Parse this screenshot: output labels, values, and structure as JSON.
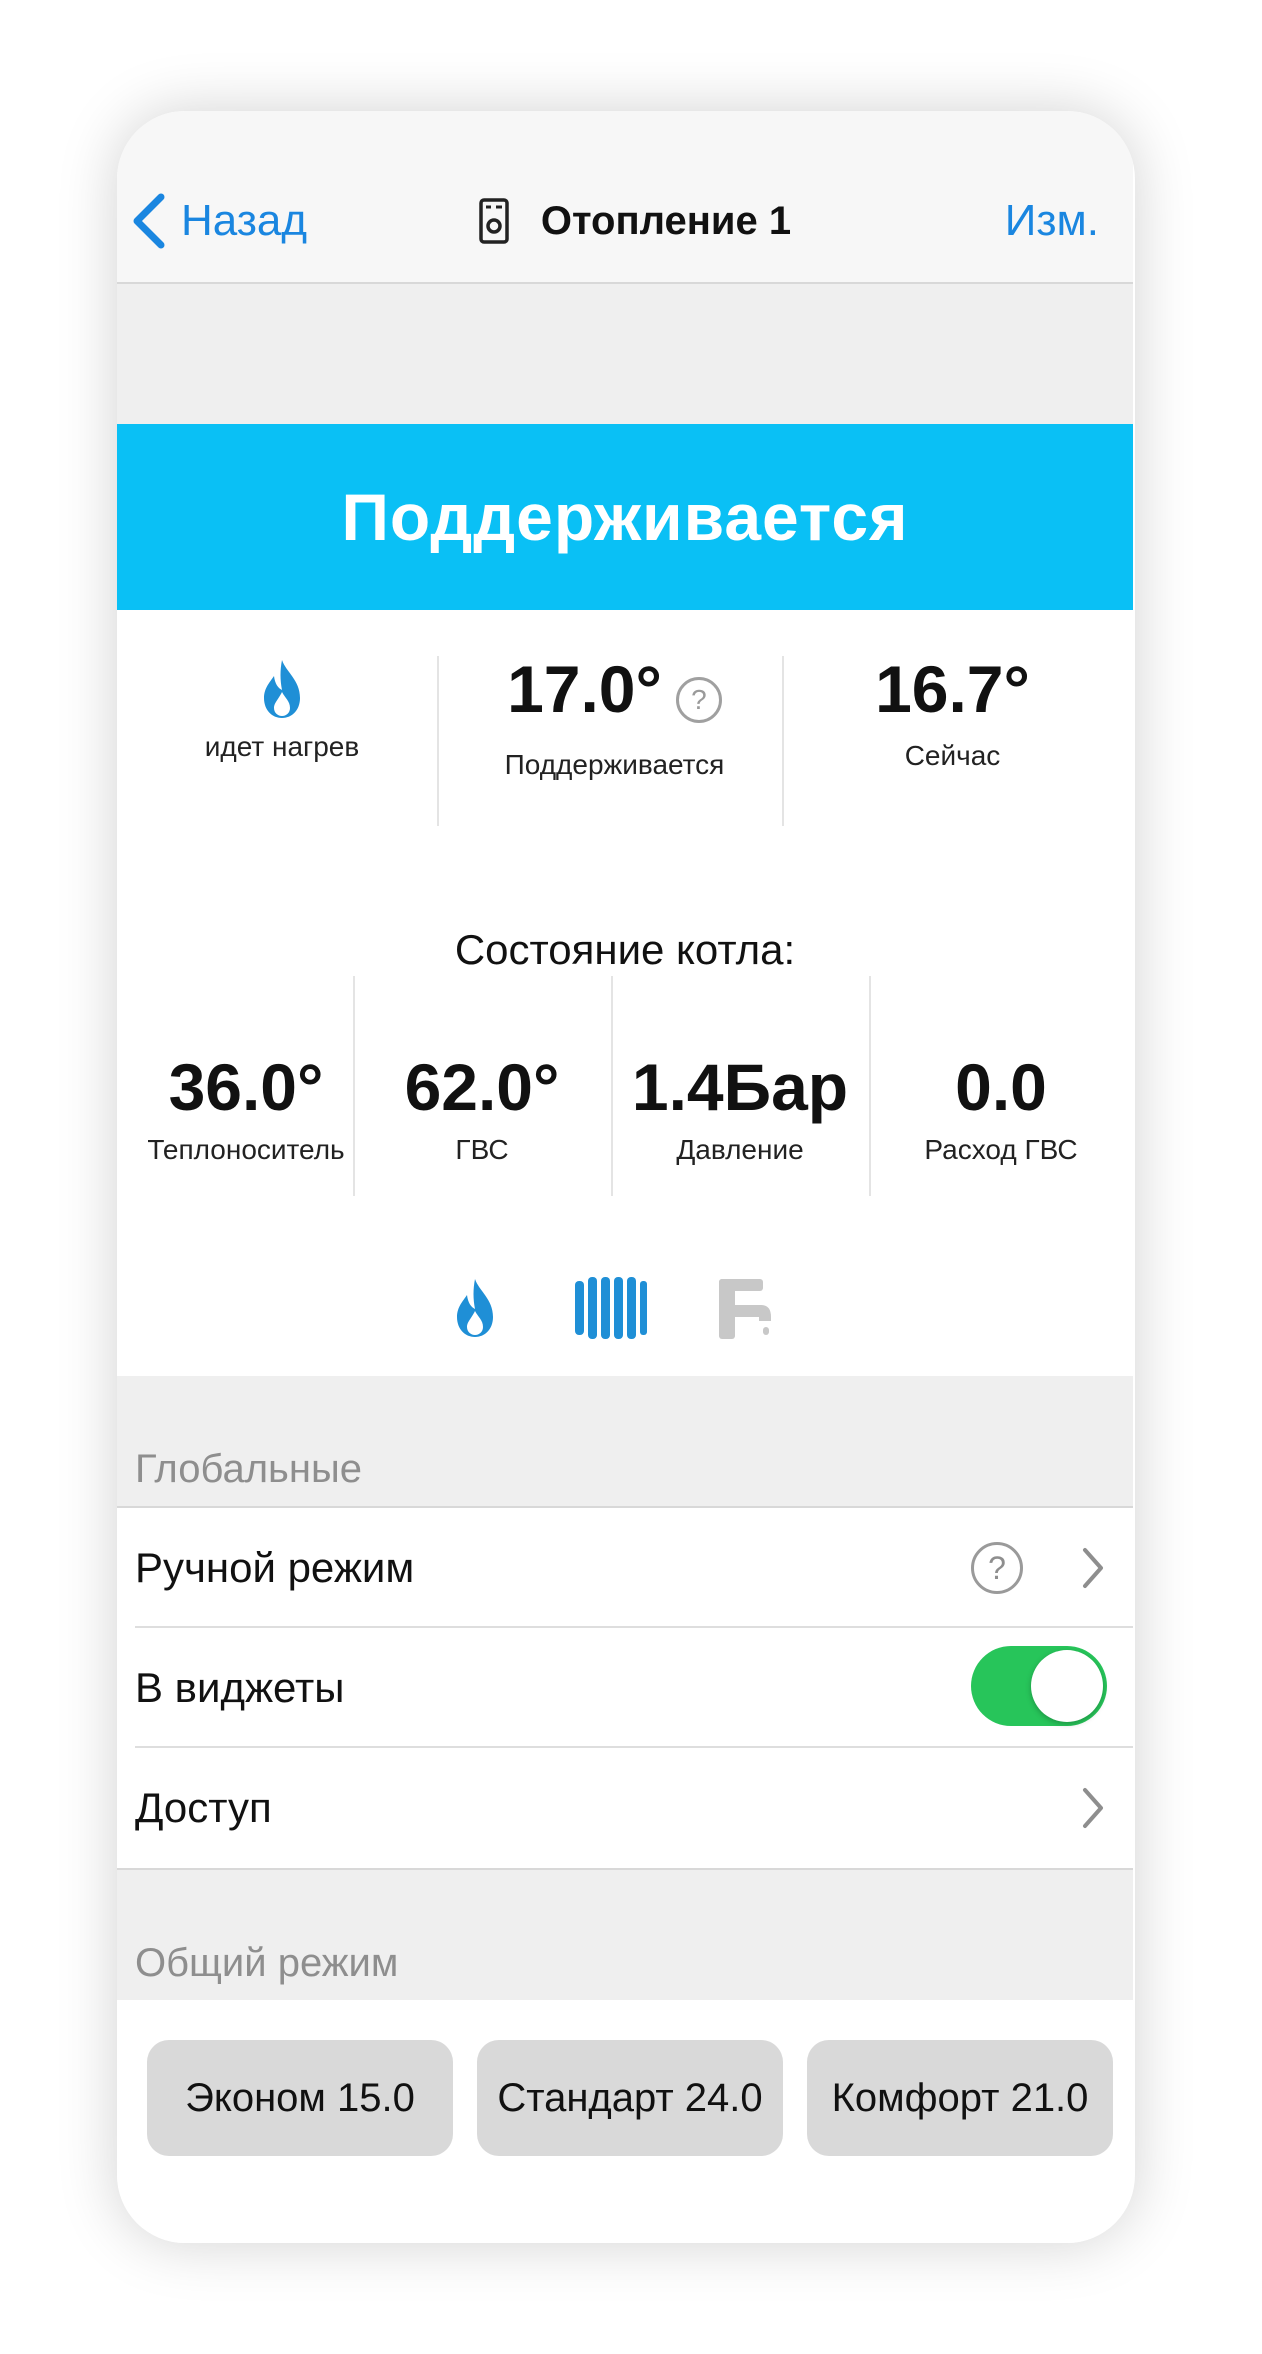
{
  "nav": {
    "back_label": "Назад",
    "title": "Отопление 1",
    "edit_label": "Изм."
  },
  "status": {
    "text": "Поддерживается"
  },
  "metrics": {
    "heating_label": "идет нагрев",
    "target_value": "17.0°",
    "target_label": "Поддерживается",
    "current_value": "16.7°",
    "current_label": "Сейчас",
    "help_glyph": "?"
  },
  "boiler": {
    "heading": "Состояние котла:",
    "items": [
      {
        "value": "36.0°",
        "label": "Теплоноситель"
      },
      {
        "value": "62.0°",
        "label": "ГВС"
      },
      {
        "value": "1.4Бар",
        "label": "Давление"
      },
      {
        "value": "0.0",
        "label": "Расход ГВС"
      }
    ],
    "mode_icons": [
      {
        "icon": "flame-icon",
        "active": true
      },
      {
        "icon": "radiator-icon",
        "active": true
      },
      {
        "icon": "faucet-icon",
        "active": false
      }
    ]
  },
  "global_section": {
    "header": "Глобальные",
    "rows": [
      {
        "label": "Ручной режим",
        "help_glyph": "?"
      },
      {
        "label": "В виджеты",
        "toggle_on": true
      },
      {
        "label": "Доступ"
      }
    ]
  },
  "mode_section": {
    "header": "Общий режим",
    "buttons": [
      "Эконом 15.0",
      "Стандарт 24.0",
      "Комфорт 21.0"
    ]
  },
  "colors": {
    "accent_blue": "#1a86e0",
    "banner": "#0ac0f5",
    "toggle_green": "#27c55a",
    "icon_blue": "#1f8fd6",
    "icon_inactive": "#c8c8c8"
  }
}
